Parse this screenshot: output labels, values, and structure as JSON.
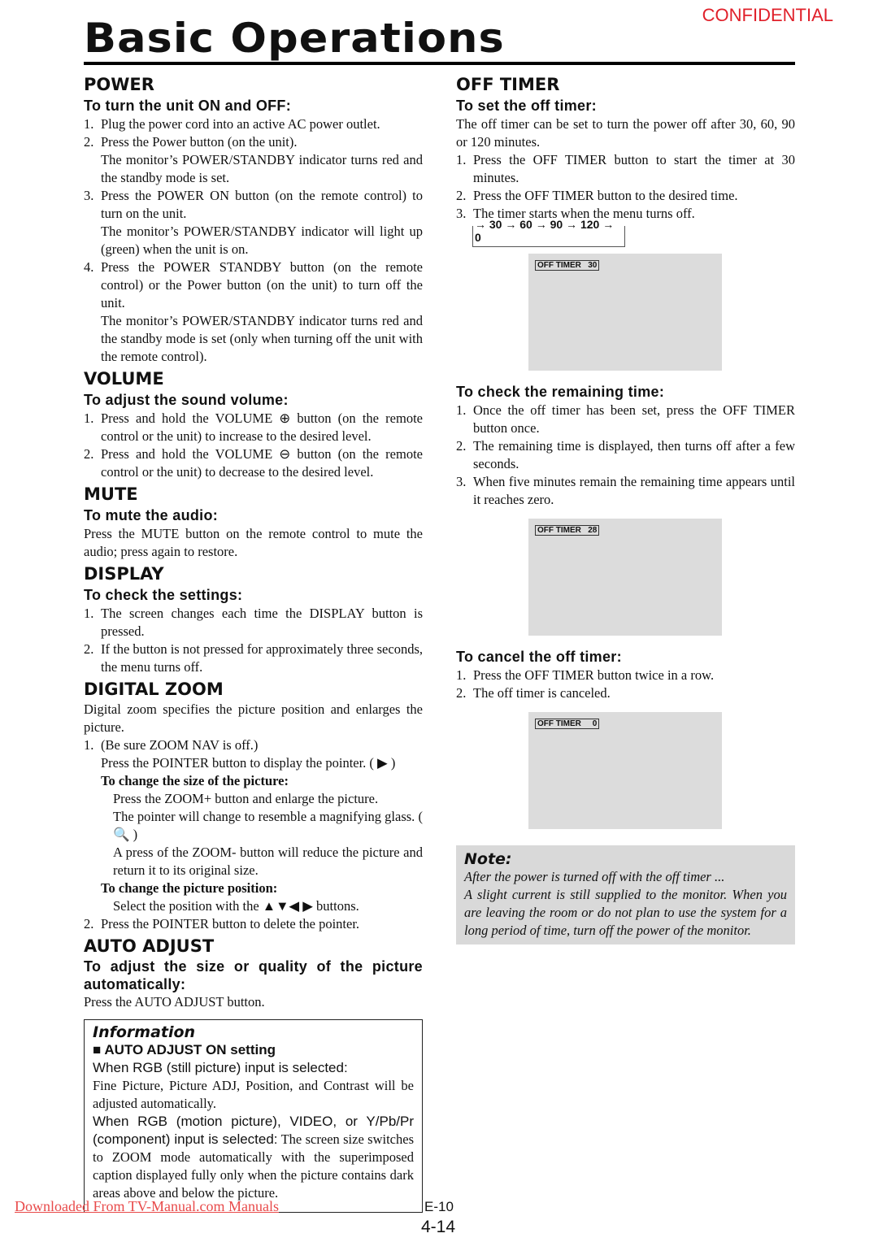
{
  "header": {
    "confidential": "CONFIDENTIAL",
    "title": "Basic Operations"
  },
  "power": {
    "heading": "POWER",
    "sub": "To turn the unit ON and OFF:",
    "items": [
      {
        "n": "1.",
        "t": "Plug the power cord into an active AC power outlet."
      },
      {
        "n": "2.",
        "t": "Press the Power button (on the unit).",
        "extra": "The monitor’s POWER/STANDBY indicator turns red and the standby mode is set."
      },
      {
        "n": "3.",
        "t": "Press the POWER ON button (on the remote control) to turn on the unit.",
        "extra": "The monitor’s POWER/STANDBY indicator will light up (green) when the unit is on."
      },
      {
        "n": "4.",
        "t": "Press the POWER STANDBY button (on the remote control) or the Power button (on the unit) to turn off the unit.",
        "extra": "The monitor’s POWER/STANDBY indicator turns red and the standby mode is set (only when turning off the unit with the remote control)."
      }
    ]
  },
  "volume": {
    "heading": "VOLUME",
    "sub": "To adjust the sound volume:",
    "items": [
      {
        "n": "1.",
        "t": "Press and hold the VOLUME ⊕ button (on the remote control or the unit) to increase to the desired level."
      },
      {
        "n": "2.",
        "t": "Press and hold the VOLUME ⊖ button (on the remote control or the unit) to decrease to the desired level."
      }
    ]
  },
  "mute": {
    "heading": "MUTE",
    "sub": "To mute the audio:",
    "text": "Press the MUTE button on the remote control to mute the audio; press again to restore."
  },
  "display": {
    "heading": "DISPLAY",
    "sub": "To check the settings:",
    "items": [
      {
        "n": "1.",
        "t": "The screen changes each time the DISPLAY button is pressed."
      },
      {
        "n": "2.",
        "t": "If the button is not pressed for approximately three seconds, the menu turns off."
      }
    ]
  },
  "zoom": {
    "heading": "DIGITAL ZOOM",
    "intro": "Digital zoom specifies the picture position and enlarges the picture.",
    "i1": "(Be sure ZOOM NAV is off.)",
    "i1b": "Press the POINTER button to display the pointer. ( ▶ )",
    "size_h": "To change the size of the picture:",
    "size1": "Press the ZOOM+ button and enlarge the picture.",
    "size2": "The pointer will change to resemble a magnifying glass. ( 🔍 )",
    "size3": "A press of the ZOOM- button will reduce the picture and return it to its original size.",
    "pos_h": "To change the picture position:",
    "pos1": "Select the position with the ▲▼◀ ▶ buttons.",
    "i2": "Press the POINTER button to delete the pointer.",
    "n1": "1.",
    "n2": "2."
  },
  "auto": {
    "heading": "AUTO ADJUST",
    "sub": "To adjust the size or quality of the picture automatically:",
    "text": "Press the AUTO ADJUST button."
  },
  "info": {
    "heading": "Information",
    "sub": "■ AUTO ADJUST ON setting",
    "l1": "When RGB (still picture) input is selected:",
    "l2": "Fine Picture, Picture ADJ, Position, and Contrast will be adjusted automatically.",
    "l3a": "When RGB (motion picture), VIDEO, or Y/Pb/Pr (component) input is selected:",
    "l3b": " The screen size switches to ZOOM mode automatically with the superimposed caption displayed fully only when the picture contains dark areas above and below the picture."
  },
  "offtimer": {
    "heading": "OFF TIMER",
    "sub": "To set the off timer:",
    "intro": "The off timer can be set to turn the power off after 30, 60, 90 or 120 minutes.",
    "items": [
      {
        "n": "1.",
        "t": "Press the OFF TIMER button to start the timer at 30 minutes."
      },
      {
        "n": "2.",
        "t": "Press the OFF TIMER button to the desired time."
      },
      {
        "n": "3.",
        "t": "The timer starts when the menu turns off."
      }
    ],
    "cycle": "→ 30 → 60 → 90 → 120 → 0",
    "osd1": "OFF TIMER   30",
    "check_sub": "To check the remaining time:",
    "check_items": [
      {
        "n": "1.",
        "t": "Once the off timer has been set, press the OFF TIMER button once."
      },
      {
        "n": "2.",
        "t": "The remaining time is displayed, then turns off after a few seconds."
      },
      {
        "n": "3.",
        "t": "When five minutes remain the remaining time appears until it reaches zero."
      }
    ],
    "osd2": "OFF TIMER   28",
    "cancel_sub": "To cancel the off timer:",
    "cancel_items": [
      {
        "n": "1.",
        "t": "Press the OFF TIMER button twice in a row."
      },
      {
        "n": "2.",
        "t": "The off timer is canceled."
      }
    ],
    "osd3": "OFF TIMER     0"
  },
  "note": {
    "heading": "Note:",
    "l1": "After the power is turned off with the off timer ...",
    "l2": "A slight current is still supplied to the monitor. When you are leaving the room or do not plan to use the system for a long period of time, turn off the power of the monitor."
  },
  "footer": {
    "download": "Downloaded From TV-Manual.com Manuals",
    "page1": "E-10",
    "page2": "4-14"
  }
}
